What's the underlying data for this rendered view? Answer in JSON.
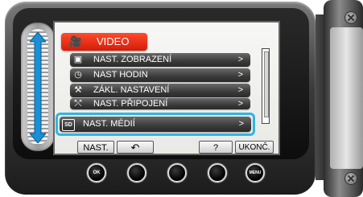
{
  "menu_tab": {
    "icon": "video-camera-icon",
    "label": "VIDEO"
  },
  "menu_items": [
    {
      "icon": "display-settings-icon",
      "label": "NAST. ZOBRAZENÍ",
      "arrow": ">"
    },
    {
      "icon": "clock-icon",
      "label": "NAST HODIN",
      "arrow": ">"
    },
    {
      "icon": "tools-icon",
      "label": "ZÁKL. NASTAVENÍ",
      "arrow": ">"
    },
    {
      "icon": "connection-icon",
      "label": "NAST. PŘIPOJENÍ",
      "arrow": ">"
    },
    {
      "icon": "sd-card-icon",
      "icon_text": "SD",
      "label": "NAST. MÉDIÍ",
      "arrow": ">",
      "selected": true
    }
  ],
  "soft_buttons": {
    "nast": "NAST.",
    "back": "↶",
    "help": "?",
    "exit": "UKONČ."
  },
  "hardware_buttons": {
    "ok": "OK",
    "menu": "MENU"
  },
  "colors": {
    "tab_red": "#e0240f",
    "selection_outline": "#2fb6e3",
    "item_dark": "#3a3a3a"
  }
}
